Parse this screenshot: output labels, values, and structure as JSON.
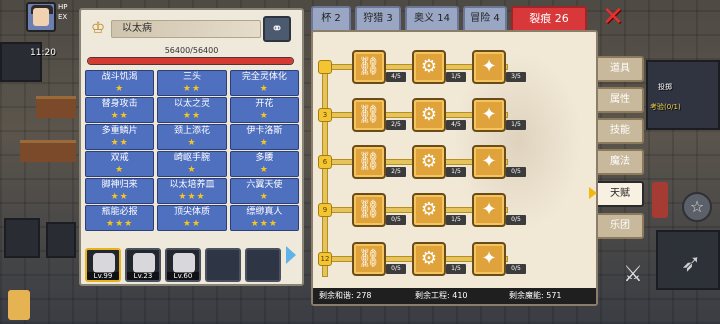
{
  "hud": {
    "hp_label": "HP",
    "ex_label": "EX",
    "clock": "11:20",
    "right_label_1": "投掷",
    "right_label_2": "考验(0/1)"
  },
  "panel": {
    "title": "以太病",
    "hp_text": "56400/56400",
    "hp_fraction": 1.0,
    "skills": [
      {
        "name": "战斗饥渴",
        "stars": "★"
      },
      {
        "name": "三头",
        "stars": "★★"
      },
      {
        "name": "完全灵体化",
        "stars": "★"
      },
      {
        "name": "替身攻击",
        "stars": "★★"
      },
      {
        "name": "以太之灵",
        "stars": "★★"
      },
      {
        "name": "开花",
        "stars": "★"
      },
      {
        "name": "多重鳞片",
        "stars": "★★"
      },
      {
        "name": "颈上添花",
        "stars": "★"
      },
      {
        "name": "伊卡洛斯",
        "stars": "★"
      },
      {
        "name": "双戒",
        "stars": "★"
      },
      {
        "name": "崎岖手腕",
        "stars": "★"
      },
      {
        "name": "多腰",
        "stars": "★"
      },
      {
        "name": "脚神归来",
        "stars": "★★"
      },
      {
        "name": "以太培养皿",
        "stars": "★★★"
      },
      {
        "name": "六翼天使",
        "stars": "★"
      },
      {
        "name": "瓶能必报",
        "stars": "★★★"
      },
      {
        "name": "顶尖体质",
        "stars": "★★"
      },
      {
        "name": "缥缈真人",
        "stars": "★★★"
      }
    ],
    "hero_slots": [
      {
        "lv": "Lv.99",
        "filled": true,
        "active": true
      },
      {
        "lv": "Lv.23",
        "filled": true,
        "active": false
      },
      {
        "lv": "Lv.60",
        "filled": true,
        "active": false
      },
      {
        "lv": "",
        "filled": false,
        "active": false
      },
      {
        "lv": "",
        "filled": false,
        "active": false
      }
    ]
  },
  "top_tabs": [
    {
      "label": "杯 2",
      "active": false
    },
    {
      "label": "狩猎 3",
      "active": false
    },
    {
      "label": "奥义 14",
      "active": false
    },
    {
      "label": "冒险 4",
      "active": false
    },
    {
      "label": "裂痕 26",
      "active": true
    }
  ],
  "tree": {
    "rows": [
      {
        "level": "",
        "counts": [
          "4/5",
          "1/5",
          "3/5"
        ]
      },
      {
        "level": "3",
        "counts": [
          "2/5",
          "4/5",
          "1/5"
        ]
      },
      {
        "level": "6",
        "counts": [
          "2/5",
          "1/5",
          "0/5"
        ]
      },
      {
        "level": "9",
        "counts": [
          "0/5",
          "1/5",
          "0/5"
        ]
      },
      {
        "level": "12",
        "counts": [
          "0/5",
          "1/5",
          "0/5"
        ]
      }
    ]
  },
  "resources": {
    "harmony": "剩余和谐: 278",
    "engineering": "剩余工程: 410",
    "magic": "剩余魔能: 571"
  },
  "side_tabs": [
    {
      "label": "道具",
      "active": false
    },
    {
      "label": "属性",
      "active": false
    },
    {
      "label": "技能",
      "active": false
    },
    {
      "label": "魔法",
      "active": false
    },
    {
      "label": "天赋",
      "active": true
    },
    {
      "label": "乐团",
      "active": false
    }
  ]
}
